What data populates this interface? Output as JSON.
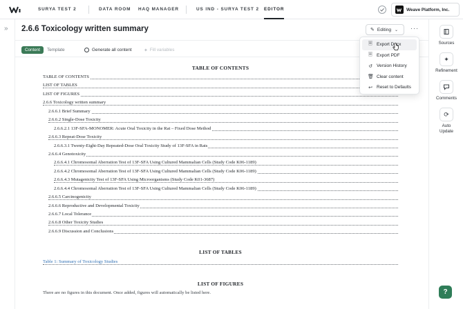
{
  "nav": {
    "project": "SURYA TEST 2",
    "data_room": "DATA ROOM",
    "haq_manager": "HAQ MANAGER",
    "us_ind": "US IND - SURYA TEST 2",
    "editor": "EDITOR"
  },
  "org": {
    "name": "Weave Platform, Inc."
  },
  "header": {
    "title": "2.6.6 Toxicology written summary",
    "editing_label": "Editing"
  },
  "toolbar": {
    "content_label": "Content",
    "template_label": "Template",
    "generate_all": "Generate all content",
    "fill_variables": "Fill variables"
  },
  "menu": {
    "items": [
      {
        "label": "Export Docx",
        "icon": "doc-icon"
      },
      {
        "label": "Export PDF",
        "icon": "doc-icon"
      },
      {
        "label": "Version History",
        "icon": "history-icon"
      },
      {
        "label": "Clear content",
        "icon": "trash-icon"
      },
      {
        "label": "Reset to Defaults",
        "icon": "reset-icon"
      }
    ]
  },
  "document": {
    "toc_heading": "TABLE OF CONTENTS",
    "toc": [
      {
        "text": "TABLE OF CONTENTS",
        "level": 0
      },
      {
        "text": "LIST OF TABLES",
        "level": 0
      },
      {
        "text": "LIST OF FIGURES",
        "level": 0
      },
      {
        "text": "2.6.6 Toxicology written summary",
        "level": 0
      },
      {
        "text": "2.6.6.1 Brief Summary",
        "level": 1
      },
      {
        "text": "2.6.6.2 Single-Dose Toxicity",
        "level": 1
      },
      {
        "text": "2.6.6.2.1 13F-SFA-MONOMER: Acute Oral Toxicity in the Rat – Fixed Dose Method",
        "level": 2
      },
      {
        "text": "2.6.6.3 Repeat-Dose Toxicity",
        "level": 1
      },
      {
        "text": "2.6.6.3.1 Twenty-Eight-Day Repeated-Dose Oral Toxicity Study of 13F-SFA in Rats",
        "level": 2
      },
      {
        "text": "2.6.6.4 Genotoxicity",
        "level": 1
      },
      {
        "text": "2.6.6.4.1 Chromosomal Aberration Test of 13F-SFA Using Cultured Mammalian Cells (Study Code K06-1189)",
        "level": 2
      },
      {
        "text": "2.6.6.4.2 Chromosomal Aberration Test of 13F-SFA Using Cultured Mammalian Cells (Study Code K06-1189)",
        "level": 2
      },
      {
        "text": "2.6.6.4.3 Mutagenicity Test of 13F-SFA Using Microorganisms (Study Code K01-3687)",
        "level": 2
      },
      {
        "text": "2.6.6.4.4 Chromosomal Aberration Test of 13F-SFA Using Cultured Mammalian Cells (Study Code K06-1189)",
        "level": 2
      },
      {
        "text": "2.6.6.5 Carcinogenicity",
        "level": 1
      },
      {
        "text": "2.6.6.6 Reproductive and Developmental Toxicity",
        "level": 1
      },
      {
        "text": "2.6.6.7 Local Tolerance",
        "level": 1
      },
      {
        "text": "2.6.6.8 Other Toxicity Studies",
        "level": 1
      },
      {
        "text": "2.6.6.9 Discussion and Conclusions",
        "level": 1
      }
    ],
    "lot_heading": "LIST OF TABLES",
    "lot_item": "Table 1: Summary of Toxicology Studies",
    "lof_heading": "LIST OF FIGURES",
    "lof_note": "There are no figures in this document. Once added, figures will automatically be listed here."
  },
  "right_panel": {
    "sources": "Sources",
    "refinement": "Refinement",
    "comments": "Comments",
    "auto_update": "Auto Update"
  },
  "help": {
    "label": "?"
  },
  "colors": {
    "accent": "#3b7a57",
    "link": "#2f6fb3"
  }
}
